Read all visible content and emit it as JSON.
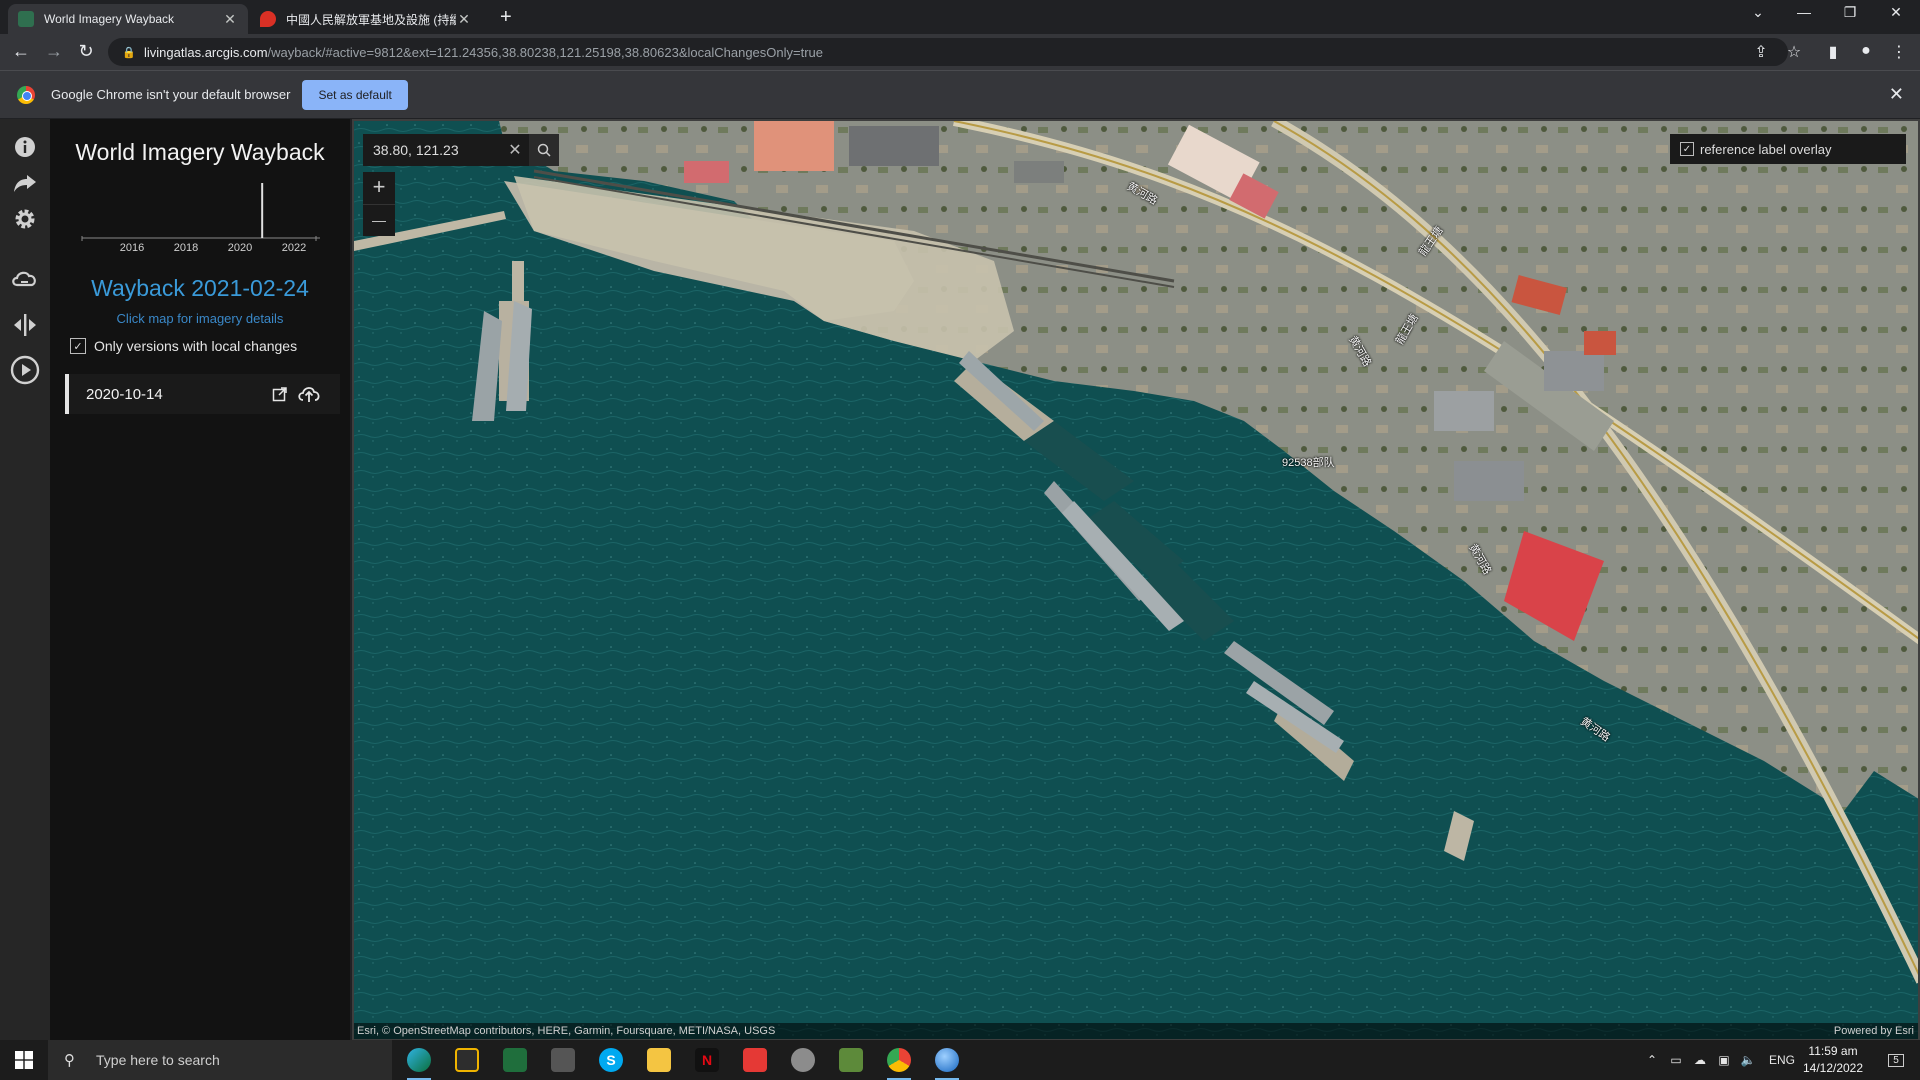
{
  "browser": {
    "tabs": [
      {
        "title": "World Imagery Wayback",
        "icon": "wayback-favicon",
        "active": true
      },
      {
        "title": "中國人民解放軍基地及設施 (持續",
        "icon": "maps-pin-favicon",
        "active": false
      }
    ],
    "address": {
      "host": "livingatlas.arcgis.com",
      "path": "/wayback/#active=9812&ext=121.24356,38.80238,121.25198,38.80623&localChangesOnly=true"
    },
    "infobar": {
      "message": "Google Chrome isn't your default browser",
      "button": "Set as default"
    }
  },
  "app": {
    "title": "World Imagery Wayback",
    "timeline": {
      "years": [
        "2016",
        "2018",
        "2020",
        "2022"
      ],
      "selected_year_fraction": 0.77
    },
    "selected_release": "Wayback 2021-02-24",
    "hint": "Click map for imagery details",
    "local_changes": {
      "label": "Only versions with local changes",
      "checked": true
    },
    "releases": [
      {
        "date": "2020-10-14"
      }
    ],
    "rail_icons": [
      "info-icon",
      "share-icon",
      "settings-icon",
      "wayback-icon",
      "swipe-icon",
      "play-icon"
    ]
  },
  "map": {
    "search_value": "38.80, 121.23",
    "zoom_in": "+",
    "zoom_out": "—",
    "reference_overlay": {
      "label": "reference label overlay",
      "checked": true
    },
    "attribution": "Esri, © OpenStreetMap contributors, HERE, Garmin, Foursquare, METI/NASA, USGS",
    "powered_by": "Powered by Esri",
    "labels": [
      {
        "text": "黄河路"
      },
      {
        "text": "黄河路"
      },
      {
        "text": "龍王塘"
      },
      {
        "text": "龍王塘"
      },
      {
        "text": "92538部队"
      },
      {
        "text": "黄河路"
      },
      {
        "text": "黄河路"
      }
    ]
  },
  "taskbar": {
    "search_placeholder": "Type here to search",
    "apps": [
      "edge",
      "store",
      "terminal-green",
      "file-explorer-dark",
      "skype",
      "folder",
      "netflix",
      "red-app",
      "shell-app",
      "minecraft",
      "chrome",
      "earth"
    ],
    "lang": "ENG",
    "time": "11:59 am",
    "date": "14/12/2022",
    "notifications": "5"
  }
}
